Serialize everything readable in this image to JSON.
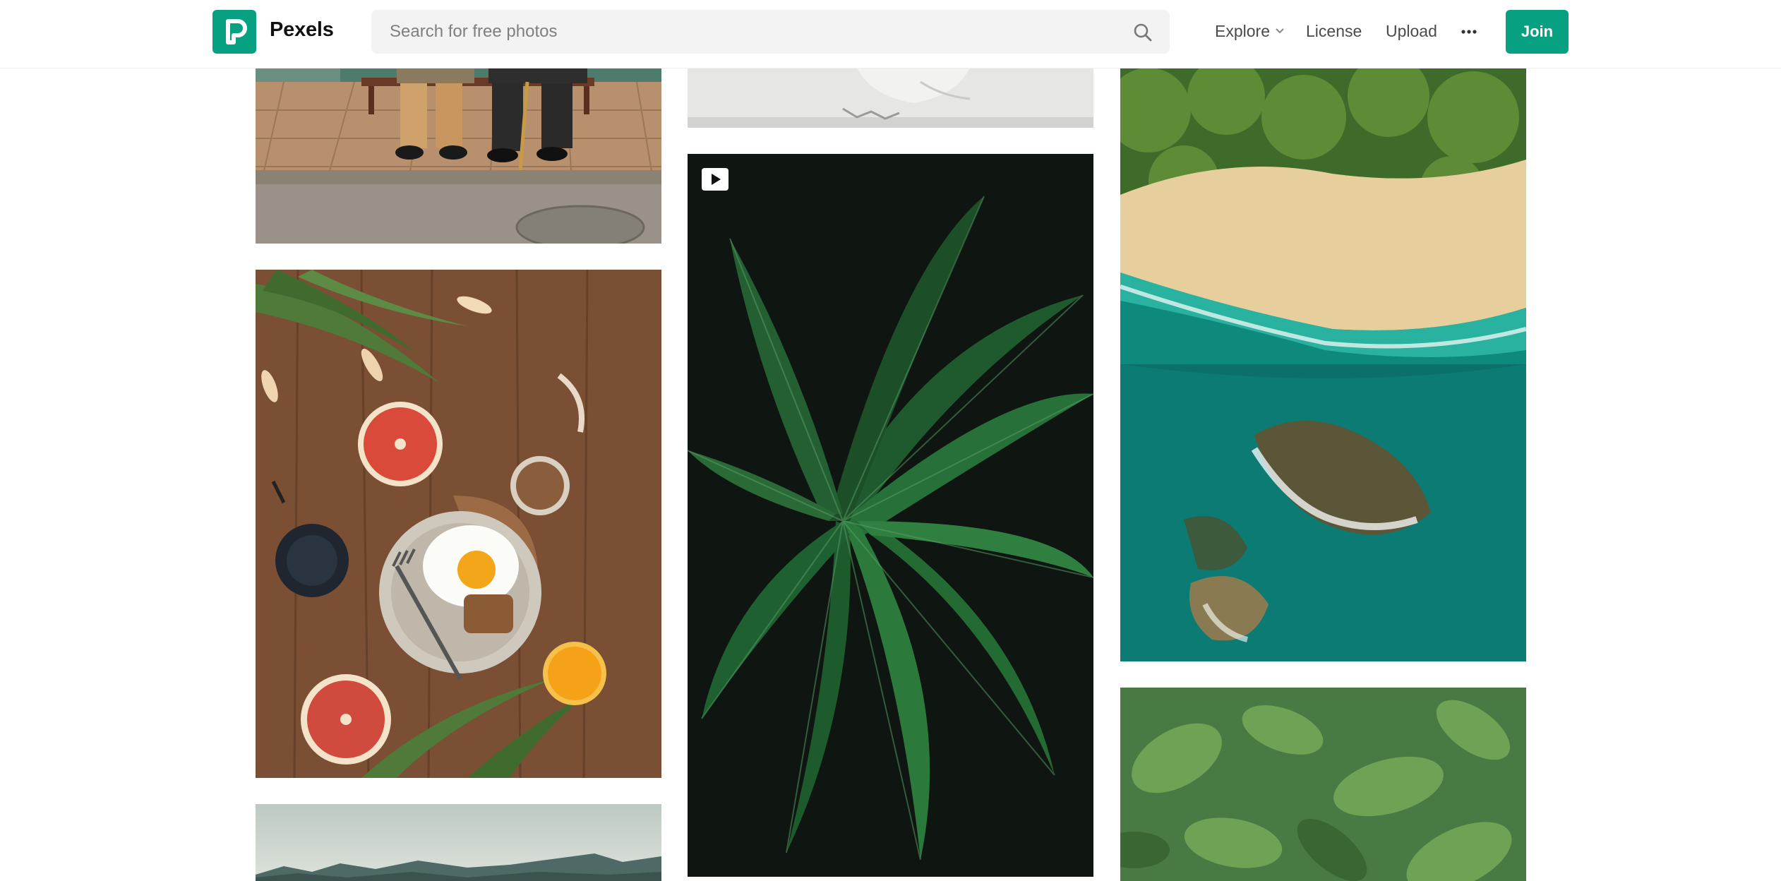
{
  "header": {
    "brand": "Pexels",
    "search": {
      "placeholder": "Search for free photos",
      "value": ""
    },
    "nav": {
      "explore": "Explore",
      "license": "License",
      "upload": "Upload"
    },
    "join_label": "Join"
  },
  "icons": {
    "logo": "pexels-logo-icon",
    "search": "search-icon",
    "explore_dropdown": "chevron-down-icon",
    "more": "more-horizontal-icon",
    "video": "video-play-icon"
  },
  "colors": {
    "brand": "#07a081",
    "search_bg": "#f3f3f3",
    "text": "#2c343e"
  },
  "photos": [
    {
      "column": 1,
      "subject": "two people sitting on a bench",
      "type": "photo"
    },
    {
      "column": 1,
      "subject": "breakfast with fried egg and grapefruit on wooden table",
      "type": "photo"
    },
    {
      "column": 1,
      "subject": "mountain landscape under pale sky",
      "type": "photo"
    },
    {
      "column": 2,
      "subject": "white textured surface",
      "type": "photo"
    },
    {
      "column": 2,
      "subject": "dark green palm leaves",
      "type": "video"
    },
    {
      "column": 3,
      "subject": "aerial view of beach, sea and rocks",
      "type": "photo"
    },
    {
      "column": 3,
      "subject": "green leaves close-up",
      "type": "photo"
    }
  ]
}
